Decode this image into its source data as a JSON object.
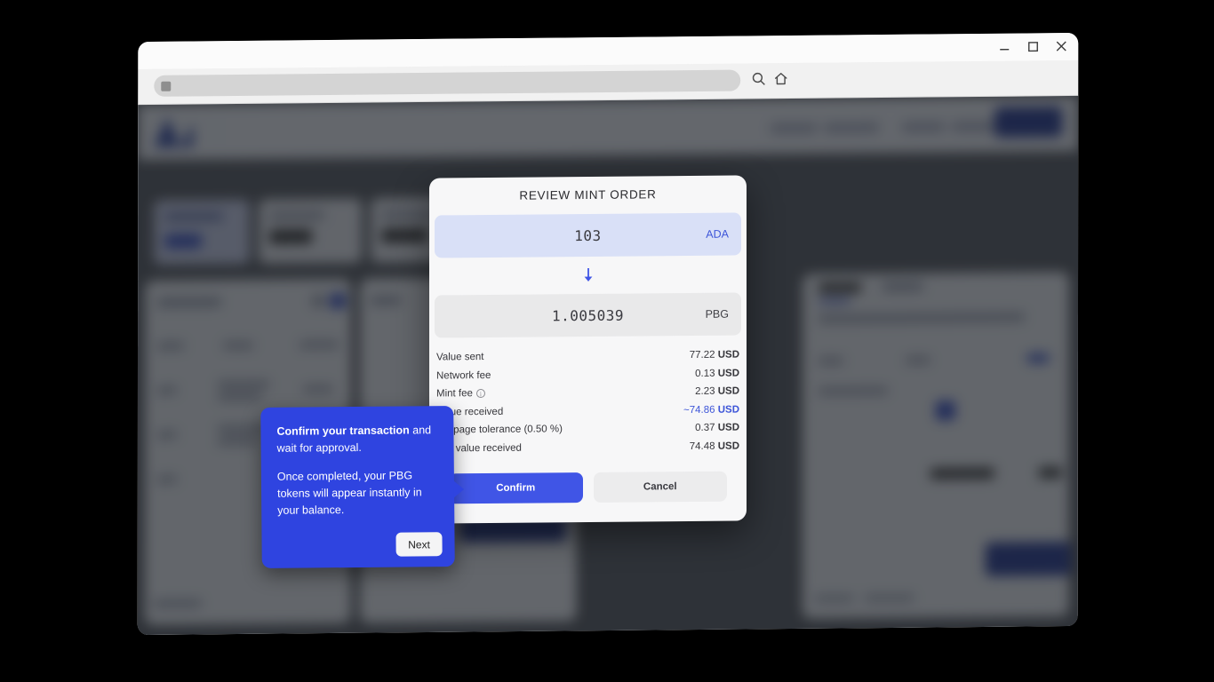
{
  "window": {
    "controls": [
      {
        "name": "minimize",
        "label": "–"
      },
      {
        "name": "maximize",
        "label": "□"
      },
      {
        "name": "close",
        "label": "✕"
      }
    ]
  },
  "browser": {
    "address_bar": {
      "value": "",
      "placeholder": "",
      "favicon": "lock-icon"
    },
    "icons": [
      "search-icon",
      "home-icon"
    ]
  },
  "modal": {
    "title": "REVIEW MINT ORDER",
    "from": {
      "amount": "103",
      "currency": "ADA"
    },
    "direction_icon": "arrow-down-icon",
    "to": {
      "amount": "1.005039",
      "currency": "PBG"
    },
    "fees": [
      {
        "label": "Value sent",
        "amount": "77.22",
        "unit": "USD",
        "highlight": false,
        "info": false
      },
      {
        "label": "Network fee",
        "amount": "0.13",
        "unit": "USD",
        "highlight": false,
        "info": false
      },
      {
        "label": "Mint fee",
        "amount": "2.23",
        "unit": "USD",
        "highlight": false,
        "info": true
      },
      {
        "label": "Value received",
        "amount": "~74.86",
        "unit": "USD",
        "highlight": true,
        "info": false
      },
      {
        "label": "Slippage tolerance (0.50 %)",
        "amount": "0.37",
        "unit": "USD",
        "highlight": false,
        "info": false
      },
      {
        "label": "Min value received",
        "amount": "74.48",
        "unit": "USD",
        "highlight": false,
        "info": false
      }
    ],
    "confirm_label": "Confirm",
    "cancel_label": "Cancel"
  },
  "coach_tooltip": {
    "line1_bold": "Confirm your transaction",
    "line1_rest": " and wait for approval.",
    "line2": "Once completed, your PBG tokens will appear instantly in your balance.",
    "next_label": "Next"
  },
  "colors": {
    "accent": "#3d55d8",
    "tooltip_bg": "#2f44e0",
    "confirm_bg": "#4055e6",
    "from_field_bg": "#d9e0f7",
    "to_field_bg": "#e9e9ea",
    "modal_bg": "#f7f7f8",
    "scrim": "rgba(20,22,28,0.62)"
  }
}
